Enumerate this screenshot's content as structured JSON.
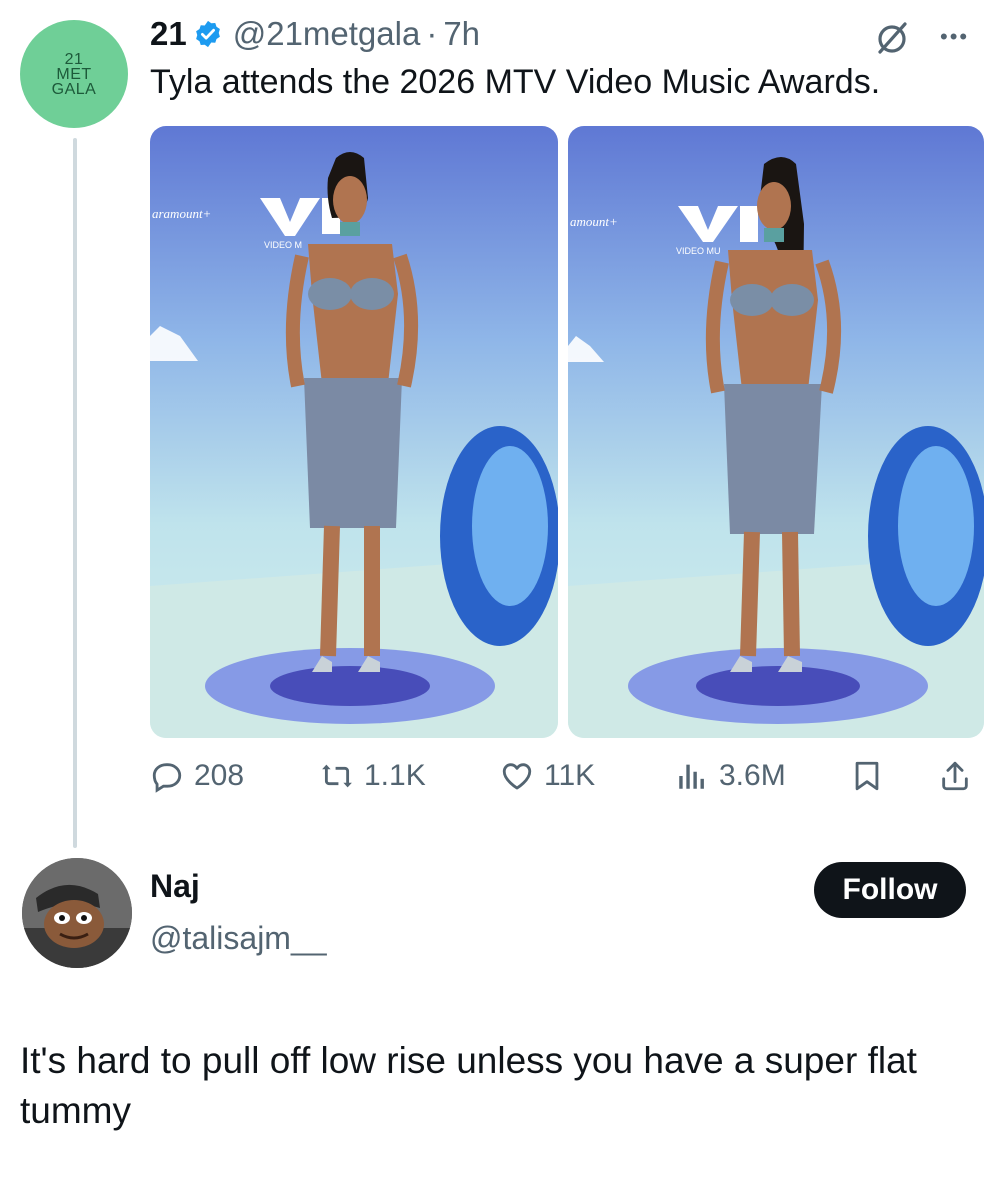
{
  "tweet": {
    "avatar_lines": [
      "21",
      "MET",
      "GALA"
    ],
    "display_name": "21",
    "handle": "@21metgala",
    "separator": "·",
    "time": "7h",
    "text": "Tyla attends the 2026 MTV Video Music Awards.",
    "media": [
      {
        "alt": "Tyla on the VMAs carpet, front view"
      },
      {
        "alt": "Tyla on the VMAs carpet, side smile"
      }
    ],
    "stats": {
      "replies": "208",
      "reposts": "1.1K",
      "likes": "11K",
      "views": "3.6M"
    },
    "icons": {
      "verified": "verified-badge-icon",
      "grok": "grok-icon",
      "more": "more-icon",
      "reply": "reply-icon",
      "repost": "repost-icon",
      "like": "heart-icon",
      "views": "views-icon",
      "bookmark": "bookmark-icon",
      "share": "share-icon"
    },
    "colors": {
      "verified": "#1d9bf0",
      "avatar_bg": "#6fcf97"
    }
  },
  "reply": {
    "display_name": "Naj",
    "handle": "@talisajm__",
    "follow_label": "Follow",
    "text": "It's hard to pull off low rise unless you have a super flat tummy"
  }
}
